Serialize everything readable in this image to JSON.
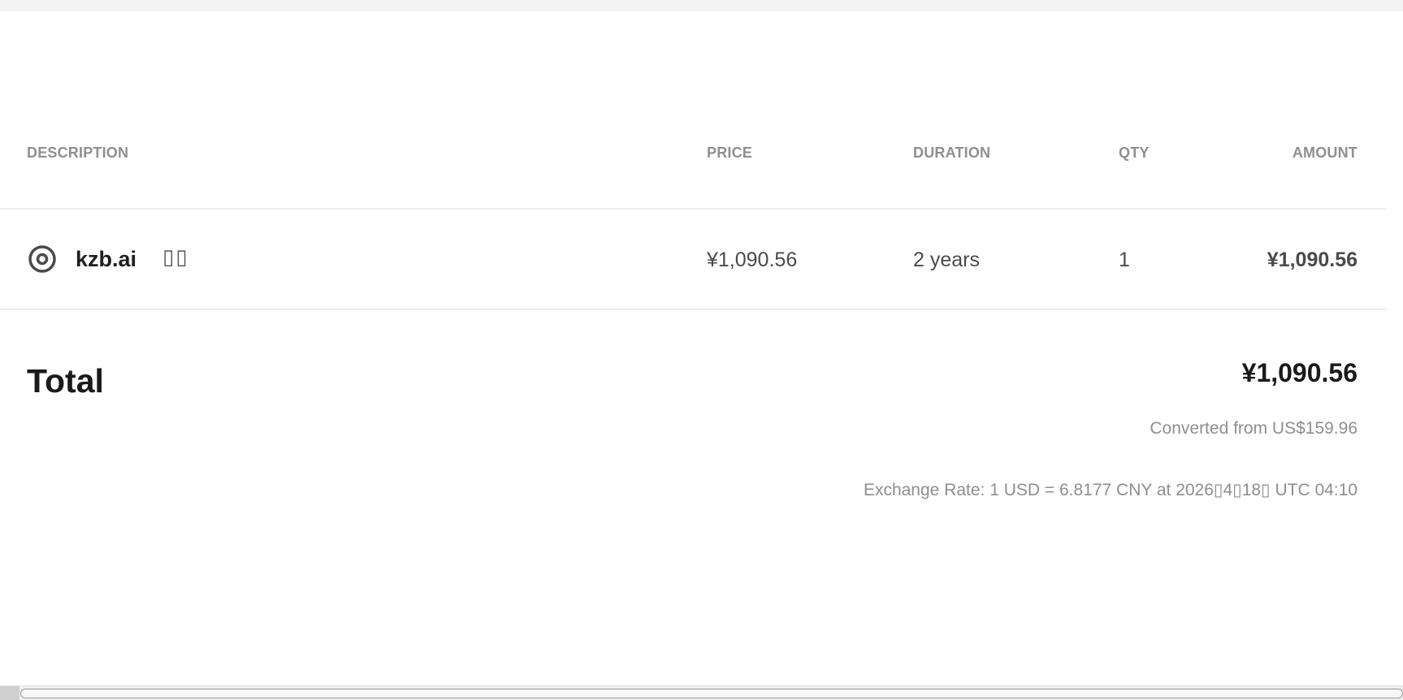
{
  "table": {
    "headers": {
      "description": "DESCRIPTION",
      "price": "PRICE",
      "duration": "DURATION",
      "qty": "QTY",
      "amount": "AMOUNT"
    },
    "items": [
      {
        "icon": "domain-target-icon",
        "name": "kzb.ai",
        "extra": "▯▯",
        "price": "¥1,090.56",
        "duration": "2 years",
        "qty": "1",
        "amount": "¥1,090.56"
      }
    ]
  },
  "summary": {
    "total_label": "Total",
    "total_value": "¥1,090.56",
    "converted": "Converted from US$159.96",
    "exchange_rate": "Exchange Rate: 1 USD = 6.8177 CNY at 2026▯4▯18▯ UTC 04:10"
  },
  "colors": {
    "header_text": "#8e8e93",
    "body_text": "#4a4a4a",
    "strong_text": "#1a1a1a",
    "muted_text": "#8e8e8e",
    "divider": "#eeeeee"
  }
}
